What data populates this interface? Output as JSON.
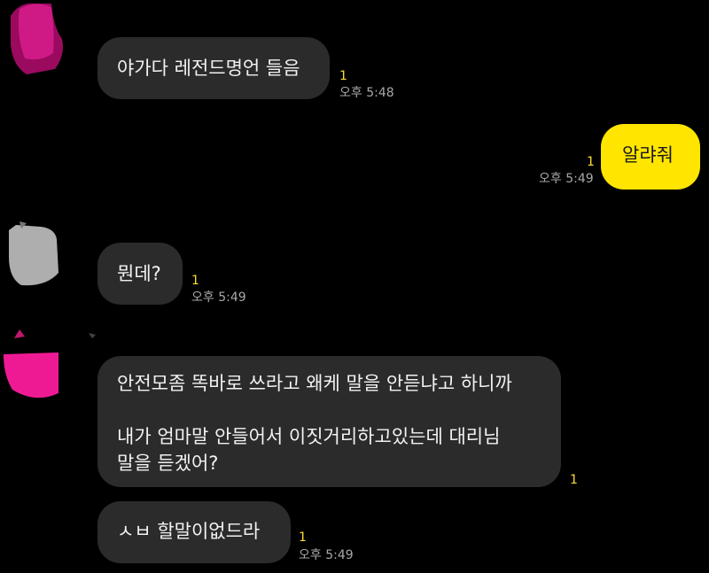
{
  "messages": [
    {
      "side": "received",
      "lines": [
        "야가다 레전드명언 들음"
      ],
      "unread": "1",
      "time": "오후 5:48"
    },
    {
      "side": "sent",
      "lines": [
        "알랴줘"
      ],
      "unread": "1",
      "time": "오후 5:49"
    },
    {
      "side": "received",
      "lines": [
        "뭔데?"
      ],
      "unread": "1",
      "time": "오후 5:49"
    },
    {
      "side": "received",
      "lines": [
        "안전모좀 똑바로 쓰라고 왜케 말을 안듣냐고 하니까",
        "",
        "내가 엄마말 안들어서 이짓거리하고있는데 대리님",
        "말을 듣겠어?"
      ],
      "unread": "1",
      "time": ""
    },
    {
      "side": "received",
      "lines": [
        "ㅅㅂ 할말이없드라"
      ],
      "unread": "1",
      "time": "오후 5:49"
    }
  ],
  "colors": {
    "background": "#000000",
    "received_bubble": "#2b2b2b",
    "sent_bubble": "#ffe500",
    "unread": "#ffde2e",
    "time": "#a8a8a8"
  }
}
